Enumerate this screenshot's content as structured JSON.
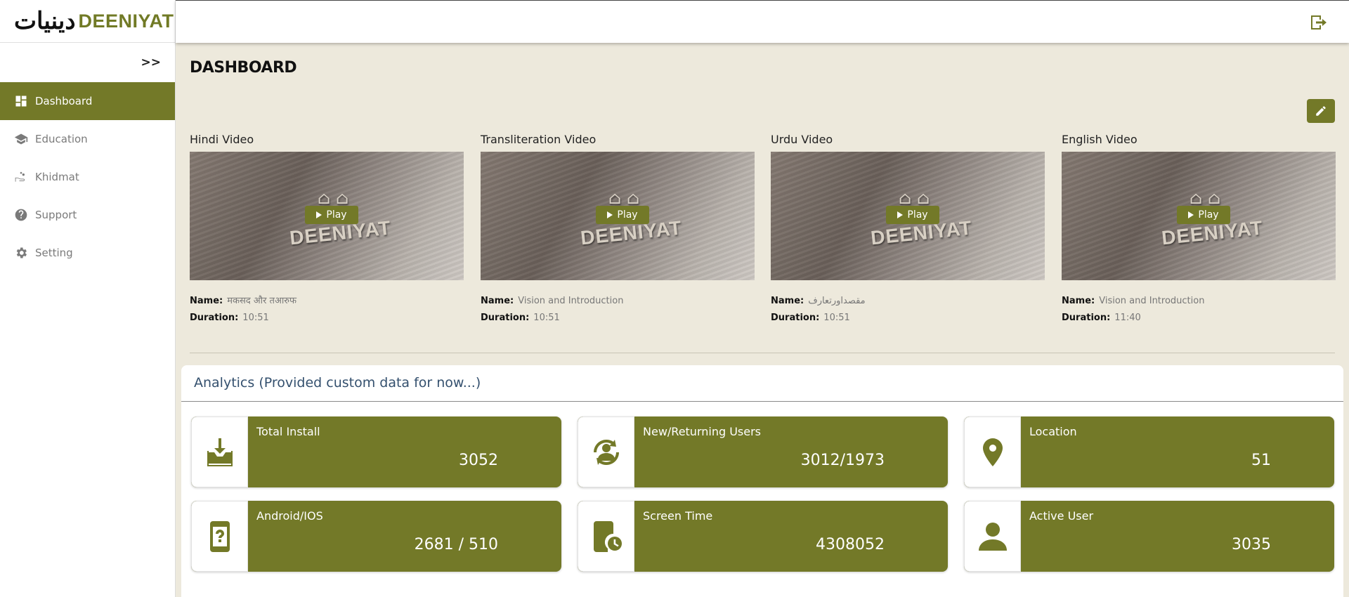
{
  "brand": {
    "arabic": "دینیات",
    "name": "DEENIYAT"
  },
  "sidebar": {
    "collapse_label": ">>",
    "items": [
      {
        "label": "Dashboard",
        "icon": "dashboard-icon",
        "active": true
      },
      {
        "label": "Education",
        "icon": "graduation-cap-icon"
      },
      {
        "label": "Khidmat",
        "icon": "hand-heart-icon"
      },
      {
        "label": "Support",
        "icon": "help-circle-icon"
      },
      {
        "label": "Setting",
        "icon": "gear-icon"
      }
    ]
  },
  "header": {
    "logout_icon": "logout-icon"
  },
  "page": {
    "title": "DASHBOARD"
  },
  "videos": [
    {
      "title": "Hindi Video",
      "play_label": "Play",
      "name_label": "Name:",
      "name": "मकसद और तआरुफ",
      "duration_label": "Duration:",
      "duration": "10:51"
    },
    {
      "title": "Transliteration Video",
      "play_label": "Play",
      "name_label": "Name:",
      "name": "Vision and Introduction",
      "duration_label": "Duration:",
      "duration": "10:51"
    },
    {
      "title": "Urdu Video",
      "play_label": "Play",
      "name_label": "Name:",
      "name": "مقصداورتعارف",
      "duration_label": "Duration:",
      "duration": "10:51"
    },
    {
      "title": "English Video",
      "play_label": "Play",
      "name_label": "Name:",
      "name": "Vision and Introduction",
      "duration_label": "Duration:",
      "duration": "11:40"
    }
  ],
  "thumbnail_watermark": "DEENIYAT",
  "analytics": {
    "title": "Analytics (Provided custom data for now...)",
    "cards": [
      {
        "label": "Total Install",
        "value": "3052",
        "icon": "download-tray-icon"
      },
      {
        "label": "New/Returning Users",
        "value": "3012/1973",
        "icon": "user-sync-icon"
      },
      {
        "label": "Location",
        "value": "51",
        "icon": "location-pin-icon"
      },
      {
        "label": "Android/IOS",
        "value": "2681 / 510",
        "icon": "device-question-icon"
      },
      {
        "label": "Screen Time",
        "value": "4308052",
        "icon": "phone-clock-icon"
      },
      {
        "label": "Active User",
        "value": "3035",
        "icon": "person-icon"
      }
    ]
  },
  "colors": {
    "accent": "#737928",
    "background": "#ede9dc",
    "analytics_title": "#34506e"
  }
}
